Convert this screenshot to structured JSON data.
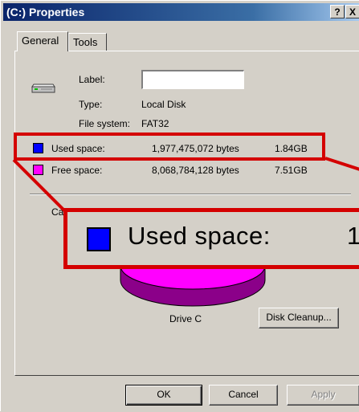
{
  "window": {
    "title": "(C:) Properties",
    "help_glyph": "?",
    "close_glyph": "X"
  },
  "tabs": [
    {
      "label": "General"
    },
    {
      "label": "Tools"
    }
  ],
  "general": {
    "label_caption": "Label:",
    "label_value": "",
    "type_caption": "Type:",
    "type_value": "Local Disk",
    "fs_caption": "File system:",
    "fs_value": "FAT32",
    "used": {
      "caption": "Used space:",
      "bytes": "1,977,475,072 bytes",
      "size": "1.84GB",
      "color": "#0000ff"
    },
    "free": {
      "caption": "Free space:",
      "bytes": "8,068,784,128 bytes",
      "size": "7.51GB",
      "color": "#ff00ff"
    },
    "capacity_caption_partial": "Ca",
    "drive_caption": "Drive C",
    "disk_cleanup": "Disk Cleanup...",
    "icons": [
      "drive-icon"
    ]
  },
  "zoom": {
    "caption": "Used space:",
    "number_partial": "1,"
  },
  "buttons": {
    "ok": "OK",
    "cancel": "Cancel",
    "apply": "Apply"
  }
}
